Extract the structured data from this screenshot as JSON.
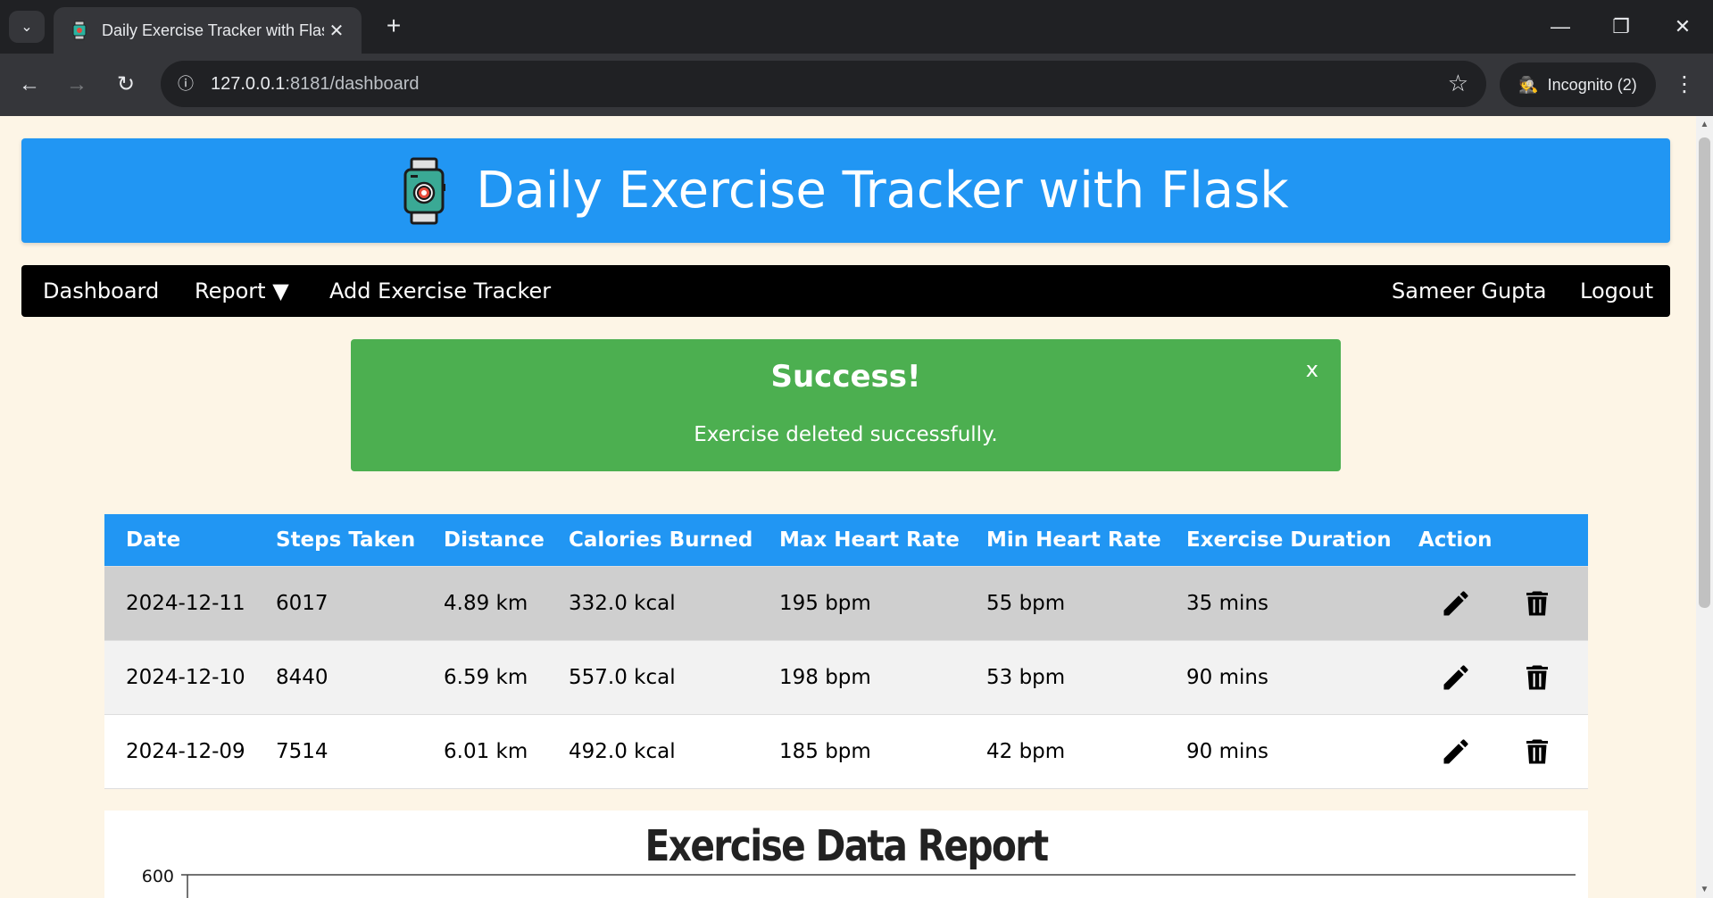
{
  "browser": {
    "tab_title": "Daily Exercise Tracker with Flask",
    "url_host": "127.0.0.1",
    "url_path": ":8181/dashboard",
    "incognito_label": "Incognito (2)"
  },
  "header": {
    "title": "Daily Exercise Tracker with Flask",
    "logo_icon": "smartwatch-icon"
  },
  "nav": {
    "dashboard": "Dashboard",
    "report": "Report ▼",
    "add": "Add Exercise Tracker",
    "user": "Sameer Gupta",
    "logout": "Logout"
  },
  "alert": {
    "title": "Success!",
    "message": "Exercise deleted successfully.",
    "close": "x",
    "color": "#4caf50"
  },
  "table": {
    "headers": [
      "Date",
      "Steps Taken",
      "Distance",
      "Calories Burned",
      "Max Heart Rate",
      "Min Heart Rate",
      "Exercise Duration",
      "Action"
    ],
    "rows": [
      [
        "2024-12-11",
        "6017",
        "4.89 km",
        "332.0 kcal",
        "195 bpm",
        "55 bpm",
        "35 mins"
      ],
      [
        "2024-12-10",
        "8440",
        "6.59 km",
        "557.0 kcal",
        "198 bpm",
        "53 bpm",
        "90 mins"
      ],
      [
        "2024-12-09",
        "7514",
        "6.01 km",
        "492.0 kcal",
        "185 bpm",
        "42 bpm",
        "90 mins"
      ]
    ],
    "actions": [
      "edit-icon",
      "delete-icon"
    ]
  },
  "report": {
    "title": "Exercise Data Report",
    "y_top_tick": "600"
  },
  "colors": {
    "primary": "#2196f3",
    "navbar": "#000000",
    "page_bg": "#fdf5e6"
  }
}
